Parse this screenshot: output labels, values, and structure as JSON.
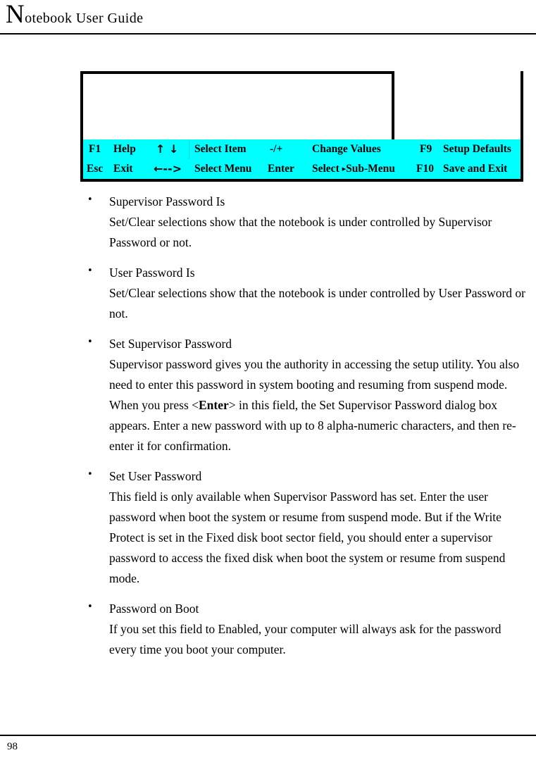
{
  "header": {
    "title_dropcap": "N",
    "title_rest": "otebook User Guide"
  },
  "bios_figure": {
    "main_panel_content": "",
    "help_panel_content": "",
    "keybar": {
      "row1": {
        "key1": "F1",
        "action1": "Help",
        "key2": "↑ ↓",
        "action2": "Select Item",
        "key3": "-/+",
        "action3": "Change Values",
        "key4": "F9",
        "action4": "Setup Defaults"
      },
      "row2": {
        "key1": "Esc",
        "action1": "Exit",
        "key2": "←-->",
        "action2": "Select Menu",
        "key3": "Enter",
        "action3_pre": "Select",
        "action3_tri": "▸",
        "action3_post": "Sub-Menu",
        "key4": "F10",
        "action4": "Save and Exit"
      }
    },
    "colors": {
      "keybar_background": "#00FFFF",
      "frame": "#000000",
      "panel_background": "#FFFFFF"
    }
  },
  "content": {
    "bullet_marker": "•",
    "items": [
      {
        "title": "Supervisor Password Is",
        "body": "Set/Clear selections show that the notebook is under controlled by Supervisor Password or not."
      },
      {
        "title": "User Password Is",
        "body": "Set/Clear selections show that the notebook is under controlled by User Password or not."
      },
      {
        "title": "Set Supervisor Password",
        "body_pre": "Supervisor password gives you the authority in accessing the setup utility. You also need to enter this password in system booting and resuming from suspend mode. When you press <",
        "body_bold": "Enter",
        "body_post": "> in this field, the Set Supervisor Password dialog box appears. Enter a new password with up to 8 alpha-numeric characters, and then re-enter it for confirmation."
      },
      {
        "title": "Set User Password",
        "body": "This field is only available when Supervisor Password has set. Enter the user password when boot the system or resume from suspend mode. But if the Write Protect is set in the Fixed disk boot sector field, you should enter a supervisor password to access the fixed disk when boot the system or resume from suspend mode."
      },
      {
        "title": "Password on Boot",
        "body": "If you set this field to Enabled, your computer will always ask for the password every time you boot your computer."
      }
    ]
  },
  "footer": {
    "page_number": "98"
  }
}
